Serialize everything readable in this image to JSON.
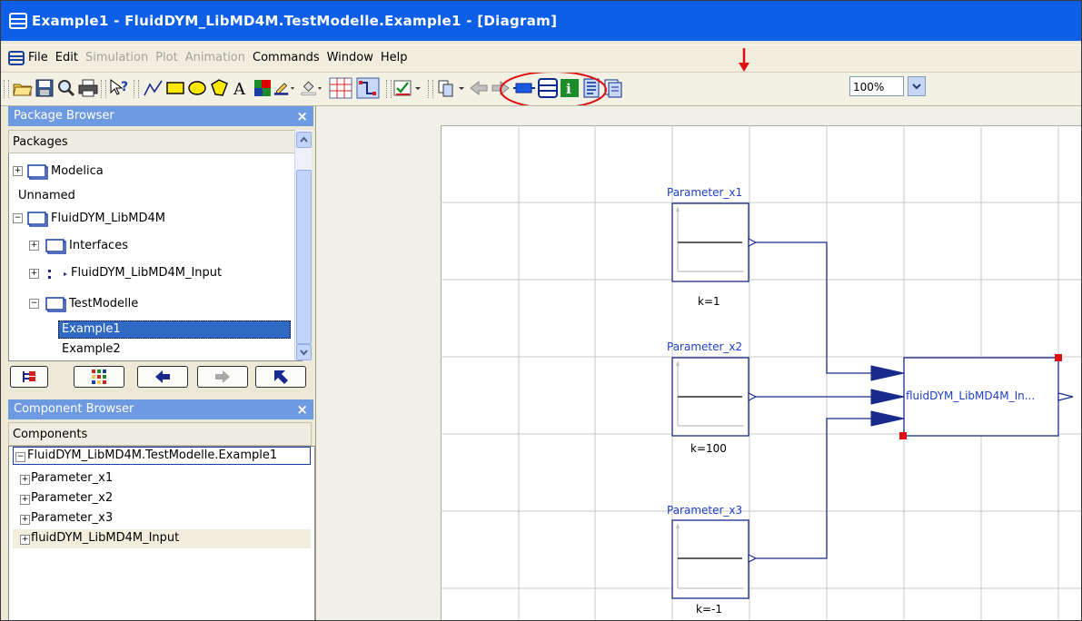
{
  "window": {
    "title": "Example1 - FluidDYM_LibMD4M.TestModelle.Example1  - [Diagram]"
  },
  "menu": {
    "items": [
      {
        "label": "File",
        "enabled": true
      },
      {
        "label": "Edit",
        "enabled": true
      },
      {
        "label": "Simulation",
        "enabled": false
      },
      {
        "label": "Plot",
        "enabled": false
      },
      {
        "label": "Animation",
        "enabled": false
      },
      {
        "label": "Commands",
        "enabled": true
      },
      {
        "label": "Window",
        "enabled": true
      },
      {
        "label": "Help",
        "enabled": true
      }
    ]
  },
  "toolbar": {
    "zoom": "100%",
    "highlight_color": "#e01010"
  },
  "package_browser": {
    "title": "Package Browser",
    "subheader": "Packages",
    "items": [
      "Modelica",
      "Unnamed",
      "FluidDYM_LibMD4M",
      "Interfaces",
      "FluidDYM_LibMD4M_Input",
      "TestModelle",
      "Example1",
      "Example2"
    ],
    "selected": "Example1"
  },
  "component_browser": {
    "title": "Component Browser",
    "subheader": "Components",
    "root": "FluidDYM_LibMD4M.TestModelle.Example1",
    "items": [
      "Parameter_x1",
      "Parameter_x2",
      "Parameter_x3",
      "fluidDYM_LibMD4M_Input"
    ]
  },
  "diagram": {
    "blocks": [
      {
        "name": "Parameter_x1",
        "param": "k=1"
      },
      {
        "name": "Parameter_x2",
        "param": "k=100"
      },
      {
        "name": "Parameter_x3",
        "param": "k=-1"
      }
    ],
    "target_block": "fluidDYM_LibMD4M_In...",
    "line_color": "#1a2a8c",
    "label_color": "#1f3fc9"
  }
}
